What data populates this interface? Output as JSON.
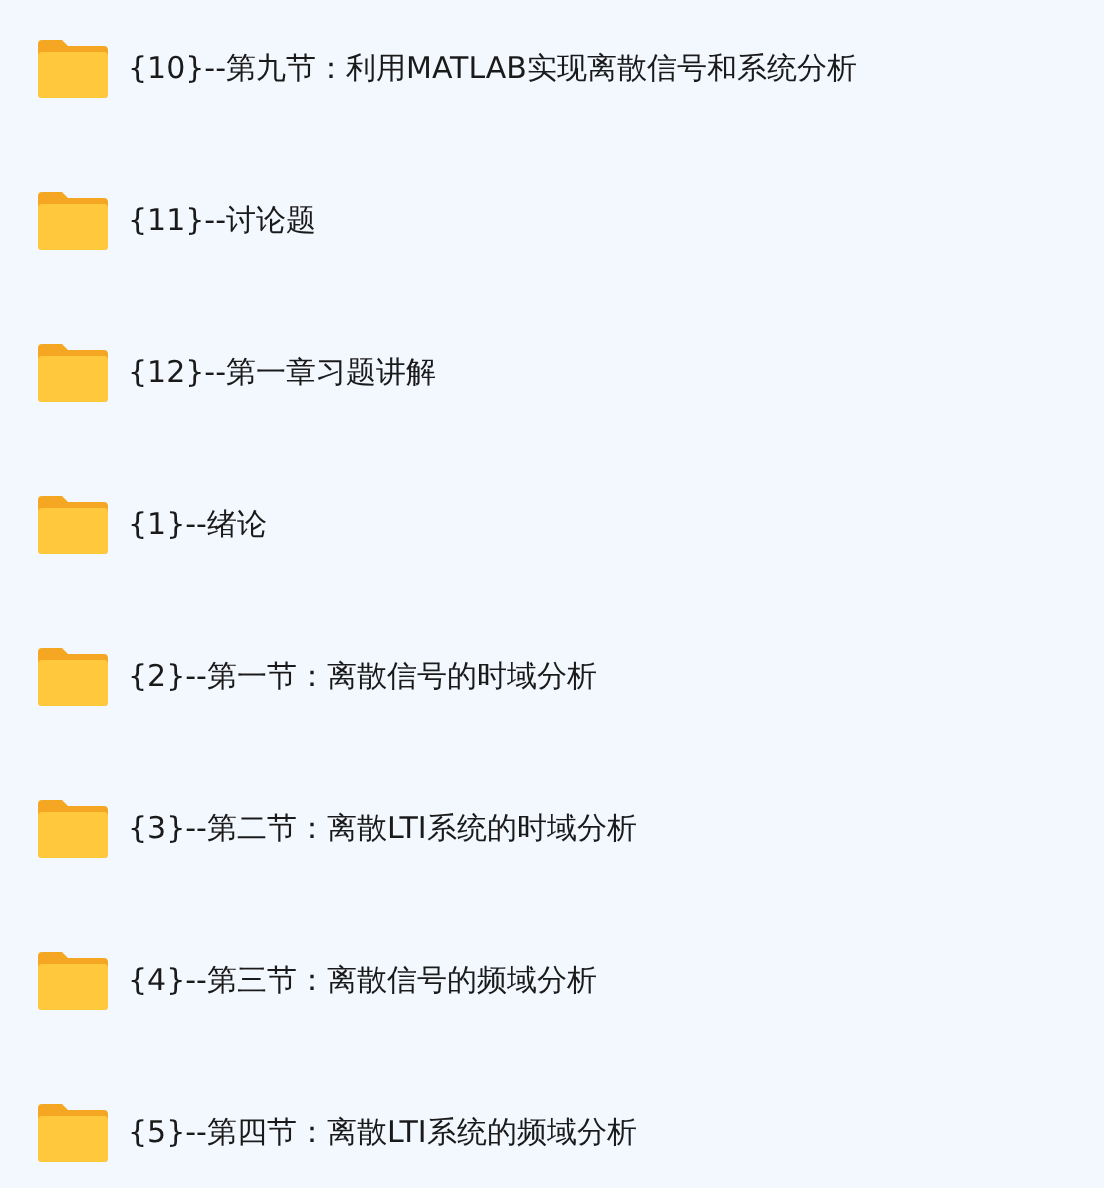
{
  "folders": [
    {
      "label": "{10}--第九节：利用MATLAB实现离散信号和系统分析"
    },
    {
      "label": "{11}--讨论题"
    },
    {
      "label": "{12}--第一章习题讲解"
    },
    {
      "label": "{1}--绪论"
    },
    {
      "label": "{2}--第一节：离散信号的时域分析"
    },
    {
      "label": "{3}--第二节：离散LTI系统的时域分析"
    },
    {
      "label": "{4}--第三节：离散信号的频域分析"
    },
    {
      "label": "{5}--第四节：离散LTI系统的频域分析"
    }
  ]
}
